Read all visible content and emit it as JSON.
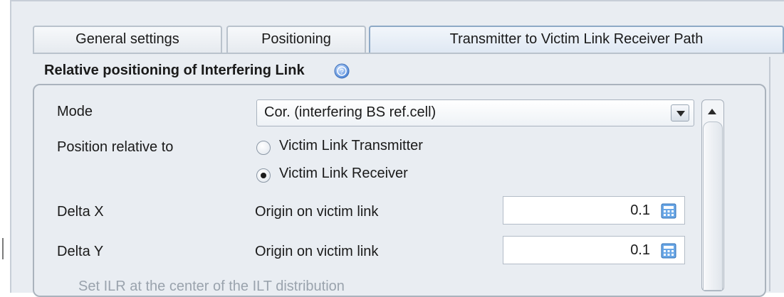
{
  "tabs": [
    {
      "label": "General settings",
      "active": false
    },
    {
      "label": "Positioning",
      "active": false
    },
    {
      "label": "Transmitter to Victim Link Receiver Path",
      "active": true
    }
  ],
  "section": {
    "title": "Relative positioning of Interfering Link",
    "help_icon": "help-icon"
  },
  "mode": {
    "label": "Mode",
    "selected": "Cor. (interfering BS ref.cell)"
  },
  "position_relative": {
    "label": "Position relative to",
    "options": [
      {
        "label": "Victim Link Transmitter",
        "checked": false
      },
      {
        "label": "Victim Link Receiver",
        "checked": true
      }
    ]
  },
  "delta_x": {
    "label": "Delta X",
    "origin_label": "Origin on victim link",
    "value": "0.1"
  },
  "delta_y": {
    "label": "Delta Y",
    "origin_label": "Origin on victim link",
    "value": "0.1"
  },
  "checkbox": {
    "label": "Set ILR at the center of the ILT distribution"
  },
  "colors": {
    "panel": "#e9edf2",
    "active_tab": "#dfe8f3",
    "border": "#aab3bd",
    "calc_icon": "#4a90d9"
  }
}
